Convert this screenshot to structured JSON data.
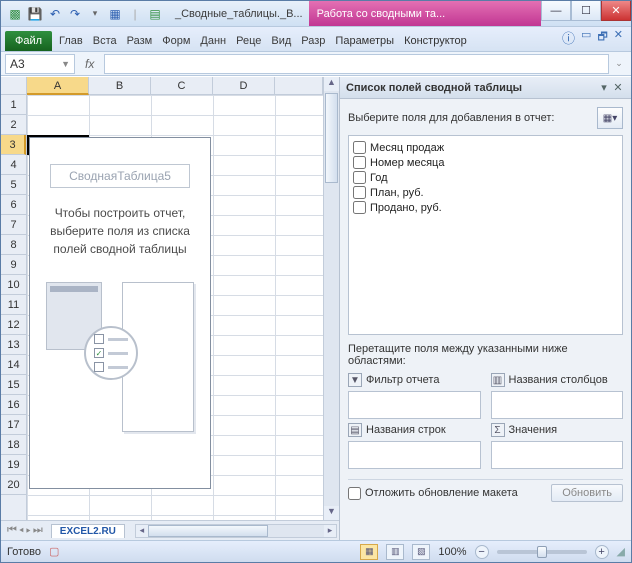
{
  "titlebar": {
    "filename": "_Сводные_таблицы._В...",
    "context_tab_group": "Работа со сводными та..."
  },
  "ribbon": {
    "file": "Файл",
    "tabs": [
      "Глав",
      "Вста",
      "Разм",
      "Форм",
      "Данн",
      "Реце",
      "Вид",
      "Разр"
    ],
    "context_tabs": [
      "Параметры",
      "Конструктор"
    ]
  },
  "namebox": {
    "value": "A3"
  },
  "formula_bar": {
    "fx_label": "fx"
  },
  "grid": {
    "columns": [
      "A",
      "B",
      "C",
      "D"
    ],
    "rows_visible": 20,
    "active_cell": "A3",
    "selected_col": "A",
    "selected_row": 3
  },
  "pivot_placeholder": {
    "title": "СводнаяТаблица5",
    "line1": "Чтобы построить отчет,",
    "line2": "выберите поля из списка",
    "line3": "полей сводной таблицы"
  },
  "sheet_tabs": {
    "active": "EXCEL2.RU"
  },
  "field_list": {
    "pane_title": "Список полей сводной таблицы",
    "prompt": "Выберите поля для добавления в отчет:",
    "fields": [
      "Месяц продаж",
      "Номер месяца",
      "Год",
      "План, руб.",
      "Продано, руб."
    ],
    "areas_prompt": "Перетащите поля между указанными ниже областями:",
    "area_filter": "Фильтр отчета",
    "area_columns": "Названия столбцов",
    "area_rows": "Названия строк",
    "area_values": "Значения",
    "defer_label": "Отложить обновление макета",
    "update_btn": "Обновить"
  },
  "statusbar": {
    "ready": "Готово",
    "zoom": "100%"
  }
}
